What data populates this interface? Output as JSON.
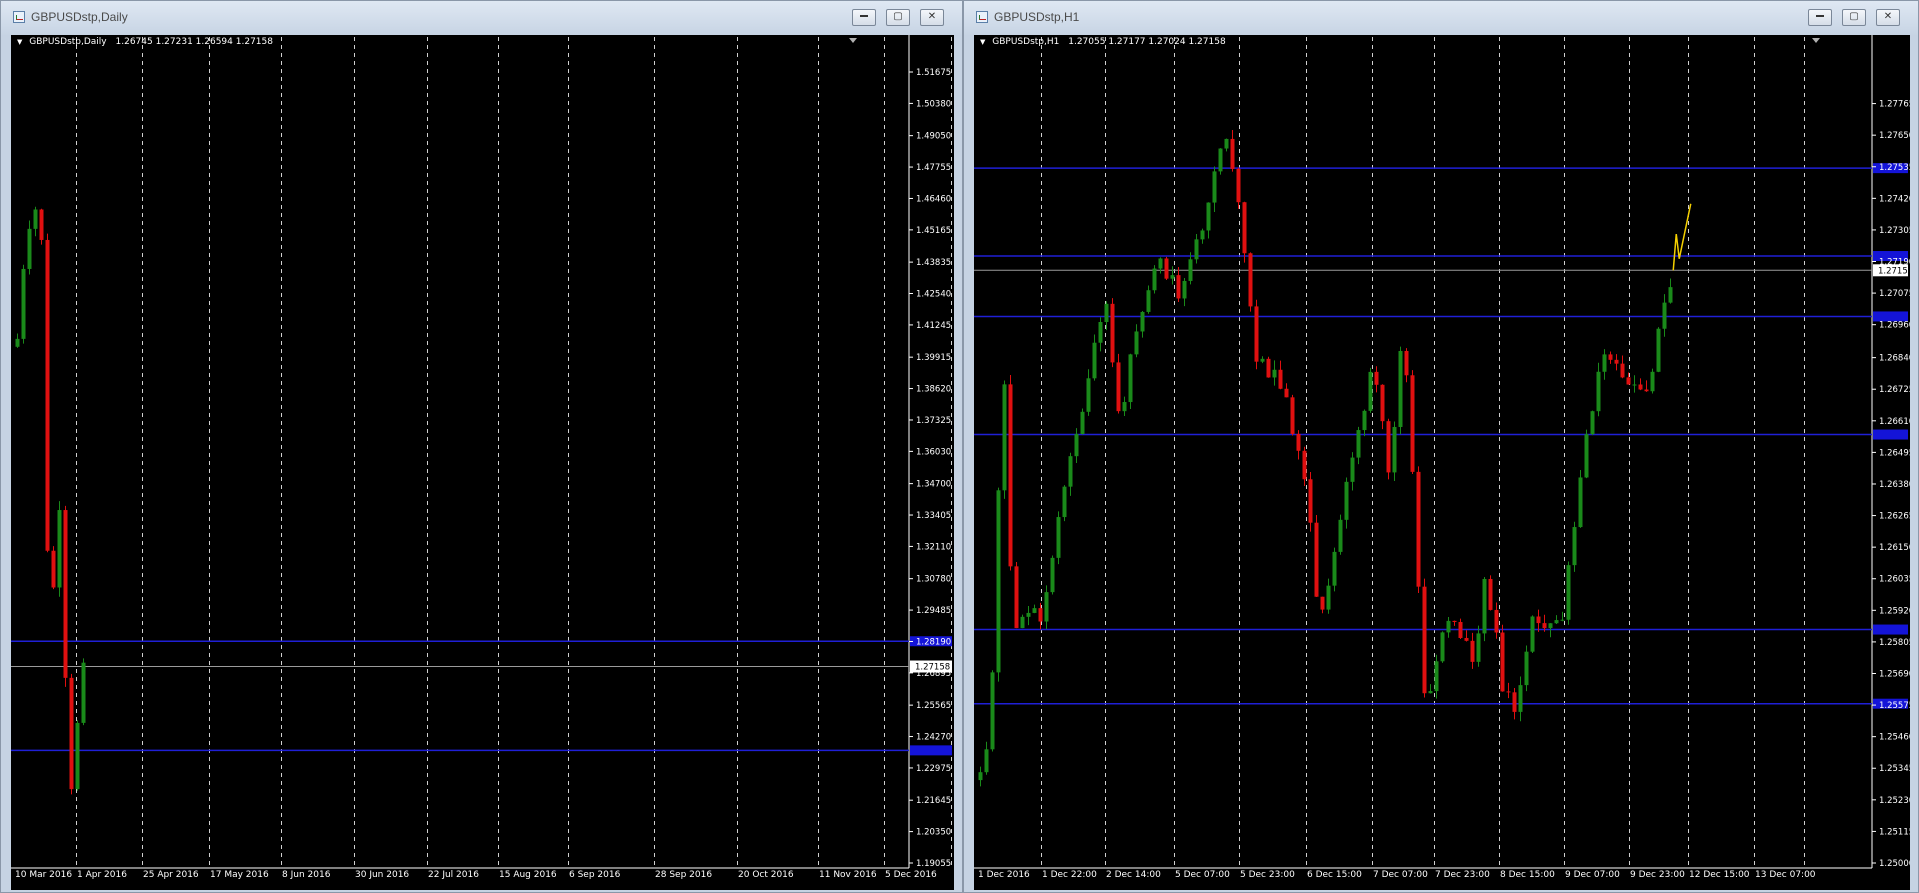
{
  "windows": [
    {
      "id": "daily",
      "title": "GBPUSDstp,Daily",
      "header_symbol": "GBPUSDstp,Daily",
      "header_values": "1.26745 1.27231 1.26594 1.27158",
      "controls": [
        "minimize",
        "maximize",
        "close"
      ],
      "chart_data": {
        "type": "candlestick",
        "timeframe": "Daily",
        "y_ticks": [
          1.51675,
          1.5038,
          1.4905,
          1.47755,
          1.4646,
          1.45165,
          1.43835,
          1.4254,
          1.41245,
          1.39915,
          1.3862,
          1.37325,
          1.3603,
          1.347,
          1.33405,
          1.3211,
          1.3078,
          1.29485,
          1.2819,
          1.26895,
          1.25565,
          1.2427,
          1.22975,
          1.21645,
          1.2035,
          1.19055
        ],
        "x_ticks": [
          "10 Mar 2016",
          "1 Apr 2016",
          "25 Apr 2016",
          "17 May 2016",
          "8 Jun 2016",
          "30 Jun 2016",
          "22 Jul 2016",
          "15 Aug 2016",
          "6 Sep 2016",
          "28 Sep 2016",
          "20 Oct 2016",
          "11 Nov 2016",
          "5 Dec 2016"
        ],
        "ylim": [
          1.19055,
          1.51675
        ],
        "current_price": 1.27158,
        "current_price_label": "1.27158",
        "horizontal_levels": [
          1.282,
          1.237
        ],
        "grid": "vertical-dashed",
        "bull_color": "#1a8a1a",
        "bear_color": "#e01010",
        "level_color": "#1f1fd6",
        "path": [
          [
            1.428,
            0
          ],
          [
            1.438,
            0.02
          ],
          [
            1.405,
            0.05
          ],
          [
            1.44,
            0.08
          ],
          [
            1.413,
            0.11
          ],
          [
            1.448,
            0.16
          ],
          [
            1.472,
            0.21
          ],
          [
            1.441,
            0.27
          ],
          [
            1.466,
            0.33
          ],
          [
            1.436,
            0.38
          ],
          [
            1.462,
            0.41
          ],
          [
            1.425,
            0.43
          ],
          [
            1.483,
            0.445
          ],
          [
            1.414,
            0.452
          ],
          [
            1.335,
            0.47
          ],
          [
            1.298,
            0.49
          ],
          [
            1.327,
            0.52
          ],
          [
            1.309,
            0.56
          ],
          [
            1.331,
            0.59
          ],
          [
            1.303,
            0.63
          ],
          [
            1.327,
            0.66
          ],
          [
            1.311,
            0.69
          ],
          [
            1.345,
            0.72
          ],
          [
            1.318,
            0.75
          ],
          [
            1.3,
            0.79
          ],
          [
            1.296,
            0.81
          ],
          [
            1.265,
            0.825
          ],
          [
            1.232,
            0.84
          ],
          [
            1.218,
            0.86
          ],
          [
            1.23,
            0.9
          ],
          [
            1.22,
            0.93
          ],
          [
            1.247,
            0.955
          ],
          [
            1.262,
            0.975
          ],
          [
            1.242,
            1.0
          ],
          [
            1.255,
            1.04
          ],
          [
            1.244,
            1.07
          ],
          [
            1.257,
            1.09
          ],
          [
            1.276,
            1.115
          ],
          [
            1.266,
            1.135
          ],
          [
            1.2716,
            1.15
          ]
        ]
      }
    },
    {
      "id": "h1",
      "title": "GBPUSDstp,H1",
      "header_symbol": "GBPUSDstp,H1",
      "header_values": "1.27055 1.27177 1.27024 1.27158",
      "controls": [
        "minimize",
        "maximize",
        "close"
      ],
      "chart_data": {
        "type": "candlestick",
        "timeframe": "H1",
        "y_ticks": [
          1.27765,
          1.2765,
          1.27535,
          1.2742,
          1.27305,
          1.2719,
          1.27075,
          1.2696,
          1.2684,
          1.26725,
          1.2661,
          1.26495,
          1.2638,
          1.26265,
          1.2615,
          1.26035,
          1.2592,
          1.25805,
          1.2569,
          1.25575,
          1.2546,
          1.25345,
          1.2523,
          1.25115,
          1.25
        ],
        "x_ticks": [
          "1 Dec 2016",
          "1 Dec 22:00",
          "2 Dec 14:00",
          "5 Dec 07:00",
          "5 Dec 23:00",
          "6 Dec 15:00",
          "7 Dec 07:00",
          "7 Dec 23:00",
          "8 Dec 15:00",
          "9 Dec 07:00",
          "9 Dec 23:00",
          "12 Dec 15:00",
          "13 Dec 07:00"
        ],
        "ylim": [
          1.25,
          1.2788
        ],
        "current_price": 1.27158,
        "current_price_label": "1.27158",
        "horizontal_levels": [
          1.2753,
          1.2721,
          1.2699,
          1.2656,
          1.2585,
          1.2558
        ],
        "grid": "vertical-dashed",
        "bull_color": "#1a8a1a",
        "bear_color": "#e01010",
        "level_color": "#1f1fd6",
        "projection_color": "#f5d000",
        "projection": [
          [
            1.27158,
            0
          ],
          [
            1.2729,
            0.12
          ],
          [
            1.272,
            0.24
          ],
          [
            1.274,
            0.7
          ]
        ],
        "path": [
          [
            1.2525,
            0
          ],
          [
            1.2545,
            0.2
          ],
          [
            1.269,
            0.4
          ],
          [
            1.258,
            0.55
          ],
          [
            1.2595,
            0.75
          ],
          [
            1.259,
            1.0
          ],
          [
            1.263,
            1.3
          ],
          [
            1.267,
            1.7
          ],
          [
            1.271,
            2.0
          ],
          [
            1.266,
            2.2
          ],
          [
            1.27,
            2.5
          ],
          [
            1.272,
            2.8
          ],
          [
            1.2705,
            3.1
          ],
          [
            1.273,
            3.4
          ],
          [
            1.2768,
            3.75
          ],
          [
            1.2735,
            4.0
          ],
          [
            1.272,
            4.1
          ],
          [
            1.2685,
            4.25
          ],
          [
            1.2675,
            4.6
          ],
          [
            1.264,
            5.0
          ],
          [
            1.2585,
            5.2
          ],
          [
            1.264,
            5.6
          ],
          [
            1.268,
            6.0
          ],
          [
            1.264,
            6.3
          ],
          [
            1.2698,
            6.5
          ],
          [
            1.262,
            6.7
          ],
          [
            1.2555,
            6.85
          ],
          [
            1.259,
            7.2
          ],
          [
            1.2575,
            7.6
          ],
          [
            1.2605,
            7.8
          ],
          [
            1.2565,
            8.05
          ],
          [
            1.2555,
            8.25
          ],
          [
            1.259,
            8.5
          ],
          [
            1.2585,
            8.95
          ],
          [
            1.265,
            9.3
          ],
          [
            1.2688,
            9.6
          ],
          [
            1.2675,
            9.9
          ],
          [
            1.2672,
            10.3
          ],
          [
            1.27,
            10.55
          ],
          [
            1.271,
            10.7
          ],
          [
            1.27158,
            10.75
          ]
        ]
      }
    }
  ]
}
